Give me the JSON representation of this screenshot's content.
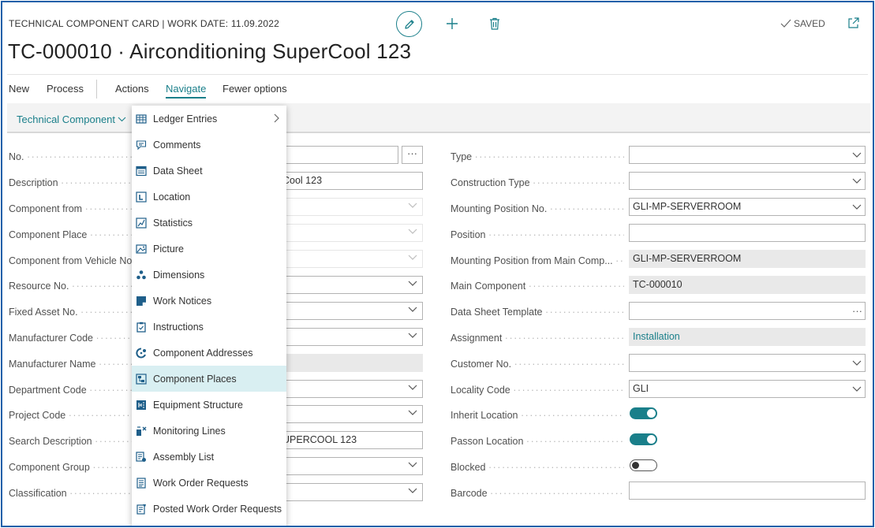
{
  "header": {
    "caption": "TECHNICAL COMPONENT CARD | WORK DATE: 11.09.2022",
    "title": "TC-000010 · Airconditioning SuperCool 123",
    "saved_label": "SAVED",
    "icons": [
      "edit-icon",
      "add-icon",
      "delete-icon",
      "check-icon",
      "popout-icon"
    ]
  },
  "actions": [
    "New",
    "Process",
    "Actions",
    "Navigate",
    "Fewer options"
  ],
  "subbar": {
    "tab": "Technical Component"
  },
  "menu": {
    "items": [
      {
        "label": "Ledger Entries",
        "icon": "ledger-icon"
      },
      {
        "label": "Comments",
        "icon": "comment-icon"
      },
      {
        "label": "Data Sheet",
        "icon": "datasheet-icon"
      },
      {
        "label": "Location",
        "icon": "location-icon"
      },
      {
        "label": "Statistics",
        "icon": "statistics-icon"
      },
      {
        "label": "Picture",
        "icon": "picture-icon"
      },
      {
        "label": "Dimensions",
        "icon": "dimensions-icon"
      },
      {
        "label": "Work Notices",
        "icon": "work-notices-icon"
      },
      {
        "label": "Instructions",
        "icon": "instructions-icon"
      },
      {
        "label": "Component Addresses",
        "icon": "addresses-icon"
      },
      {
        "label": "Component Places",
        "icon": "places-icon"
      },
      {
        "label": "Equipment Structure",
        "icon": "structure-icon"
      },
      {
        "label": "Monitoring Lines",
        "icon": "monitoring-icon"
      },
      {
        "label": "Assembly List",
        "icon": "assembly-icon"
      },
      {
        "label": "Work Order Requests",
        "icon": "work-order-icon"
      },
      {
        "label": "Posted Work Order Requests",
        "icon": "posted-work-order-icon"
      }
    ]
  },
  "left_fields": [
    {
      "label": "No.",
      "value": ""
    },
    {
      "label": "Description",
      "value": "Cool 123"
    },
    {
      "label": "Component from",
      "value": ""
    },
    {
      "label": "Component Place",
      "value": ""
    },
    {
      "label": "Component from Vehicle No",
      "value": ""
    },
    {
      "label": "Resource No.",
      "value": ""
    },
    {
      "label": "Fixed Asset No.",
      "value": ""
    },
    {
      "label": "Manufacturer Code",
      "value": ""
    },
    {
      "label": "Manufacturer Name",
      "value": ""
    },
    {
      "label": "Department Code",
      "value": ""
    },
    {
      "label": "Project Code",
      "value": ""
    },
    {
      "label": "Search Description",
      "value": "UPERCOOL 123"
    },
    {
      "label": "Component Group",
      "value": ""
    },
    {
      "label": "Classification",
      "value": ""
    }
  ],
  "right_fields": [
    {
      "label": "Type",
      "value": ""
    },
    {
      "label": "Construction Type",
      "value": ""
    },
    {
      "label": "Mounting Position No.",
      "value": "GLI-MP-SERVERROOM"
    },
    {
      "label": "Position",
      "value": ""
    },
    {
      "label": "Mounting Position from Main Comp...",
      "value": "GLI-MP-SERVERROOM"
    },
    {
      "label": "Main Component",
      "value": "TC-000010"
    },
    {
      "label": "Data Sheet Template",
      "value": ""
    },
    {
      "label": "Assignment",
      "value": "Installation"
    },
    {
      "label": "Customer No.",
      "value": ""
    },
    {
      "label": "Locality Code",
      "value": "GLI"
    },
    {
      "label": "Inherit Location",
      "value": true
    },
    {
      "label": "Passon Location",
      "value": true
    },
    {
      "label": "Blocked",
      "value": false
    },
    {
      "label": "Barcode",
      "value": ""
    }
  ],
  "colors": {
    "accent": "#1a7f8a",
    "frame": "#1f5fa8",
    "highlight": "#d9eff2"
  }
}
